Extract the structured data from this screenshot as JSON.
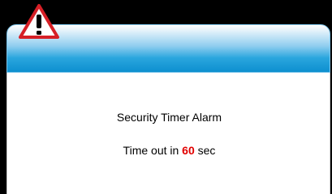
{
  "dialog": {
    "icon": "warning-icon",
    "title": "Security Timer Alarm",
    "timeout_prefix": "Time out in",
    "timeout_value": "60",
    "timeout_suffix": "sec"
  },
  "colors": {
    "header_top": "#ffffff",
    "header_bottom": "#0d8fcf",
    "timeout_value": "#e10000",
    "background": "#000000"
  }
}
